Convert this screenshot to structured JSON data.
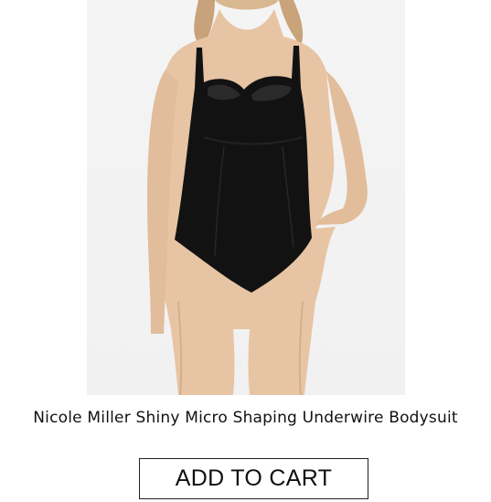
{
  "product": {
    "title": "Nicole Miller Shiny Micro Shaping Underwire Bodysuit",
    "image_alt": "Model wearing a black shiny underwire shaping bodysuit"
  },
  "cart": {
    "button_label": "ADD TO CART"
  },
  "colors": {
    "product_color": "#111111",
    "background": "#ffffff"
  }
}
